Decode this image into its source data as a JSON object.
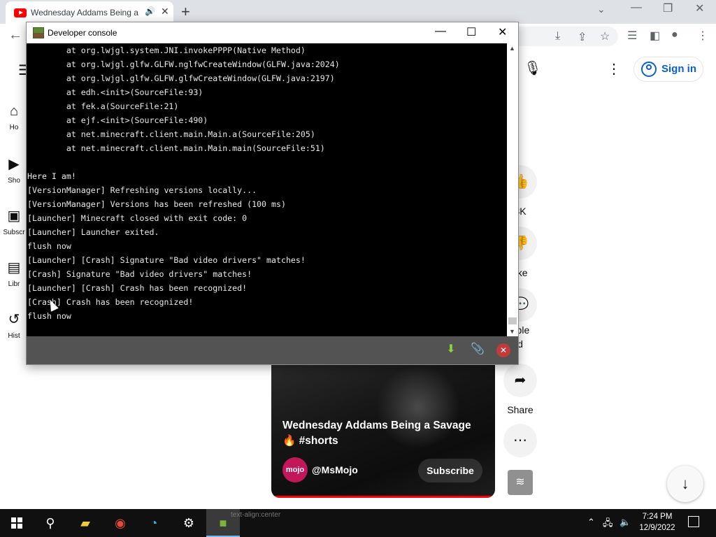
{
  "browser": {
    "tab_title": "Wednesday Addams Being a",
    "tab_audio_icon": "speaker-icon",
    "tab_close": "✕",
    "new_tab": "+",
    "tab_list": "⌄",
    "window_minimize": "—",
    "window_restore": "❐",
    "window_close": "✕",
    "back": "←",
    "toolbar_icons": [
      "install-icon",
      "share-icon",
      "bookmark-star-icon",
      "reading-list-icon",
      "side-panel-icon",
      "profile-icon",
      "kebab-menu-icon"
    ]
  },
  "youtube": {
    "menu": "☰",
    "guide": [
      {
        "label": "Ho",
        "icon": "home-icon"
      },
      {
        "label": "Sho",
        "icon": "shorts-icon"
      },
      {
        "label": "Subscr",
        "icon": "subscriptions-icon"
      },
      {
        "label": "Libr",
        "icon": "library-icon"
      },
      {
        "label": "Hist",
        "icon": "history-icon"
      }
    ],
    "sign_in": "Sign in",
    "actions": [
      {
        "icon": "like-icon",
        "label": "3K"
      },
      {
        "icon": "dislike-icon",
        "label": "like"
      },
      {
        "icon": "comments-icon",
        "label": "able\nd"
      },
      {
        "icon": "share-icon",
        "label": "Share"
      },
      {
        "icon": "more-icon",
        "label": ""
      }
    ],
    "short": {
      "title": "Wednesday Addams Being a Savage 🔥 #shorts",
      "channel_avatar": "mojo",
      "channel": "@MsMojo",
      "subscribe": "Subscribe"
    }
  },
  "console": {
    "title": "Developer console",
    "log_lines": [
      "        at org.lwjgl.system.JNI.invokePPPP(Native Method)",
      "        at org.lwjgl.glfw.GLFW.nglfwCreateWindow(GLFW.java:2024)",
      "        at org.lwjgl.glfw.GLFW.glfwCreateWindow(GLFW.java:2197)",
      "        at edh.<init>(SourceFile:93)",
      "        at fek.a(SourceFile:21)",
      "        at ejf.<init>(SourceFile:490)",
      "        at net.minecraft.client.main.Main.a(SourceFile:205)",
      "        at net.minecraft.client.main.Main.main(SourceFile:51)",
      "",
      "Here I am!",
      "[VersionManager] Refreshing versions locally...",
      "[VersionManager] Versions has been refreshed (100 ms)",
      "[Launcher] Minecraft closed with exit code: 0",
      "[Launcher] Launcher exited.",
      "flush now",
      "[Launcher] [Crash] Signature \"Bad video drivers\" matches!",
      "[Crash] Signature \"Bad video drivers\" matches!",
      "[Launcher] [Crash] Crash has been recognized!",
      "[Crash] Crash has been recognized!",
      "flush now"
    ],
    "footer_icons": [
      "download-icon",
      "attach-paperclip-icon",
      "close-circle-icon"
    ]
  },
  "taskbar": {
    "ghost_text": "text-align:center",
    "time": "7:24 PM",
    "date": "12/9/2022",
    "apps": [
      "start-icon",
      "search-icon",
      "file-explorer-icon",
      "chrome-icon",
      "edge-icon",
      "settings-icon",
      "minecraft-launcher-icon"
    ]
  }
}
